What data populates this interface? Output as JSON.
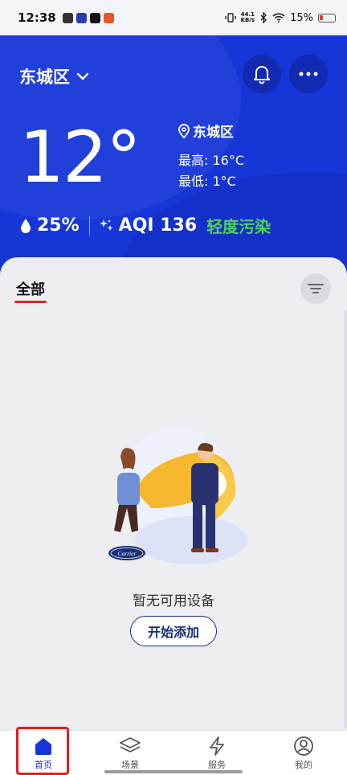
{
  "status_bar": {
    "time": "12:38",
    "net_speed_top": "44.1",
    "net_speed_unit": "KB/s",
    "battery": "15%"
  },
  "header": {
    "city": "东城区",
    "temperature": "12°",
    "location": "东城区",
    "high": "最高: 16°C",
    "low": "最低: 1°C",
    "humidity": "25%",
    "aqi": "AQI 136",
    "aqi_level": "轻度污染",
    "icons": {
      "dropdown": "chevron-down-icon",
      "bell": "bell-icon",
      "more": "more-icon",
      "location": "location-pin-icon",
      "humidity": "droplet-icon",
      "aqi": "sparkle-icon"
    }
  },
  "content": {
    "tab_all": "全部",
    "empty_text": "暂无可用设备",
    "add_button": "开始添加",
    "brand": "Carrier"
  },
  "bottom_nav": {
    "items": [
      {
        "label": "首页",
        "icon": "home-icon",
        "active": true
      },
      {
        "label": "场景",
        "icon": "layers-icon",
        "active": false
      },
      {
        "label": "服务",
        "icon": "bolt-icon",
        "active": false
      },
      {
        "label": "我的",
        "icon": "user-icon",
        "active": false
      }
    ]
  },
  "colors": {
    "brand_blue": "#1636d8",
    "aqi_green": "#4fd05a",
    "tab_red": "#d8262c",
    "highlight_red": "#e01e1e"
  }
}
